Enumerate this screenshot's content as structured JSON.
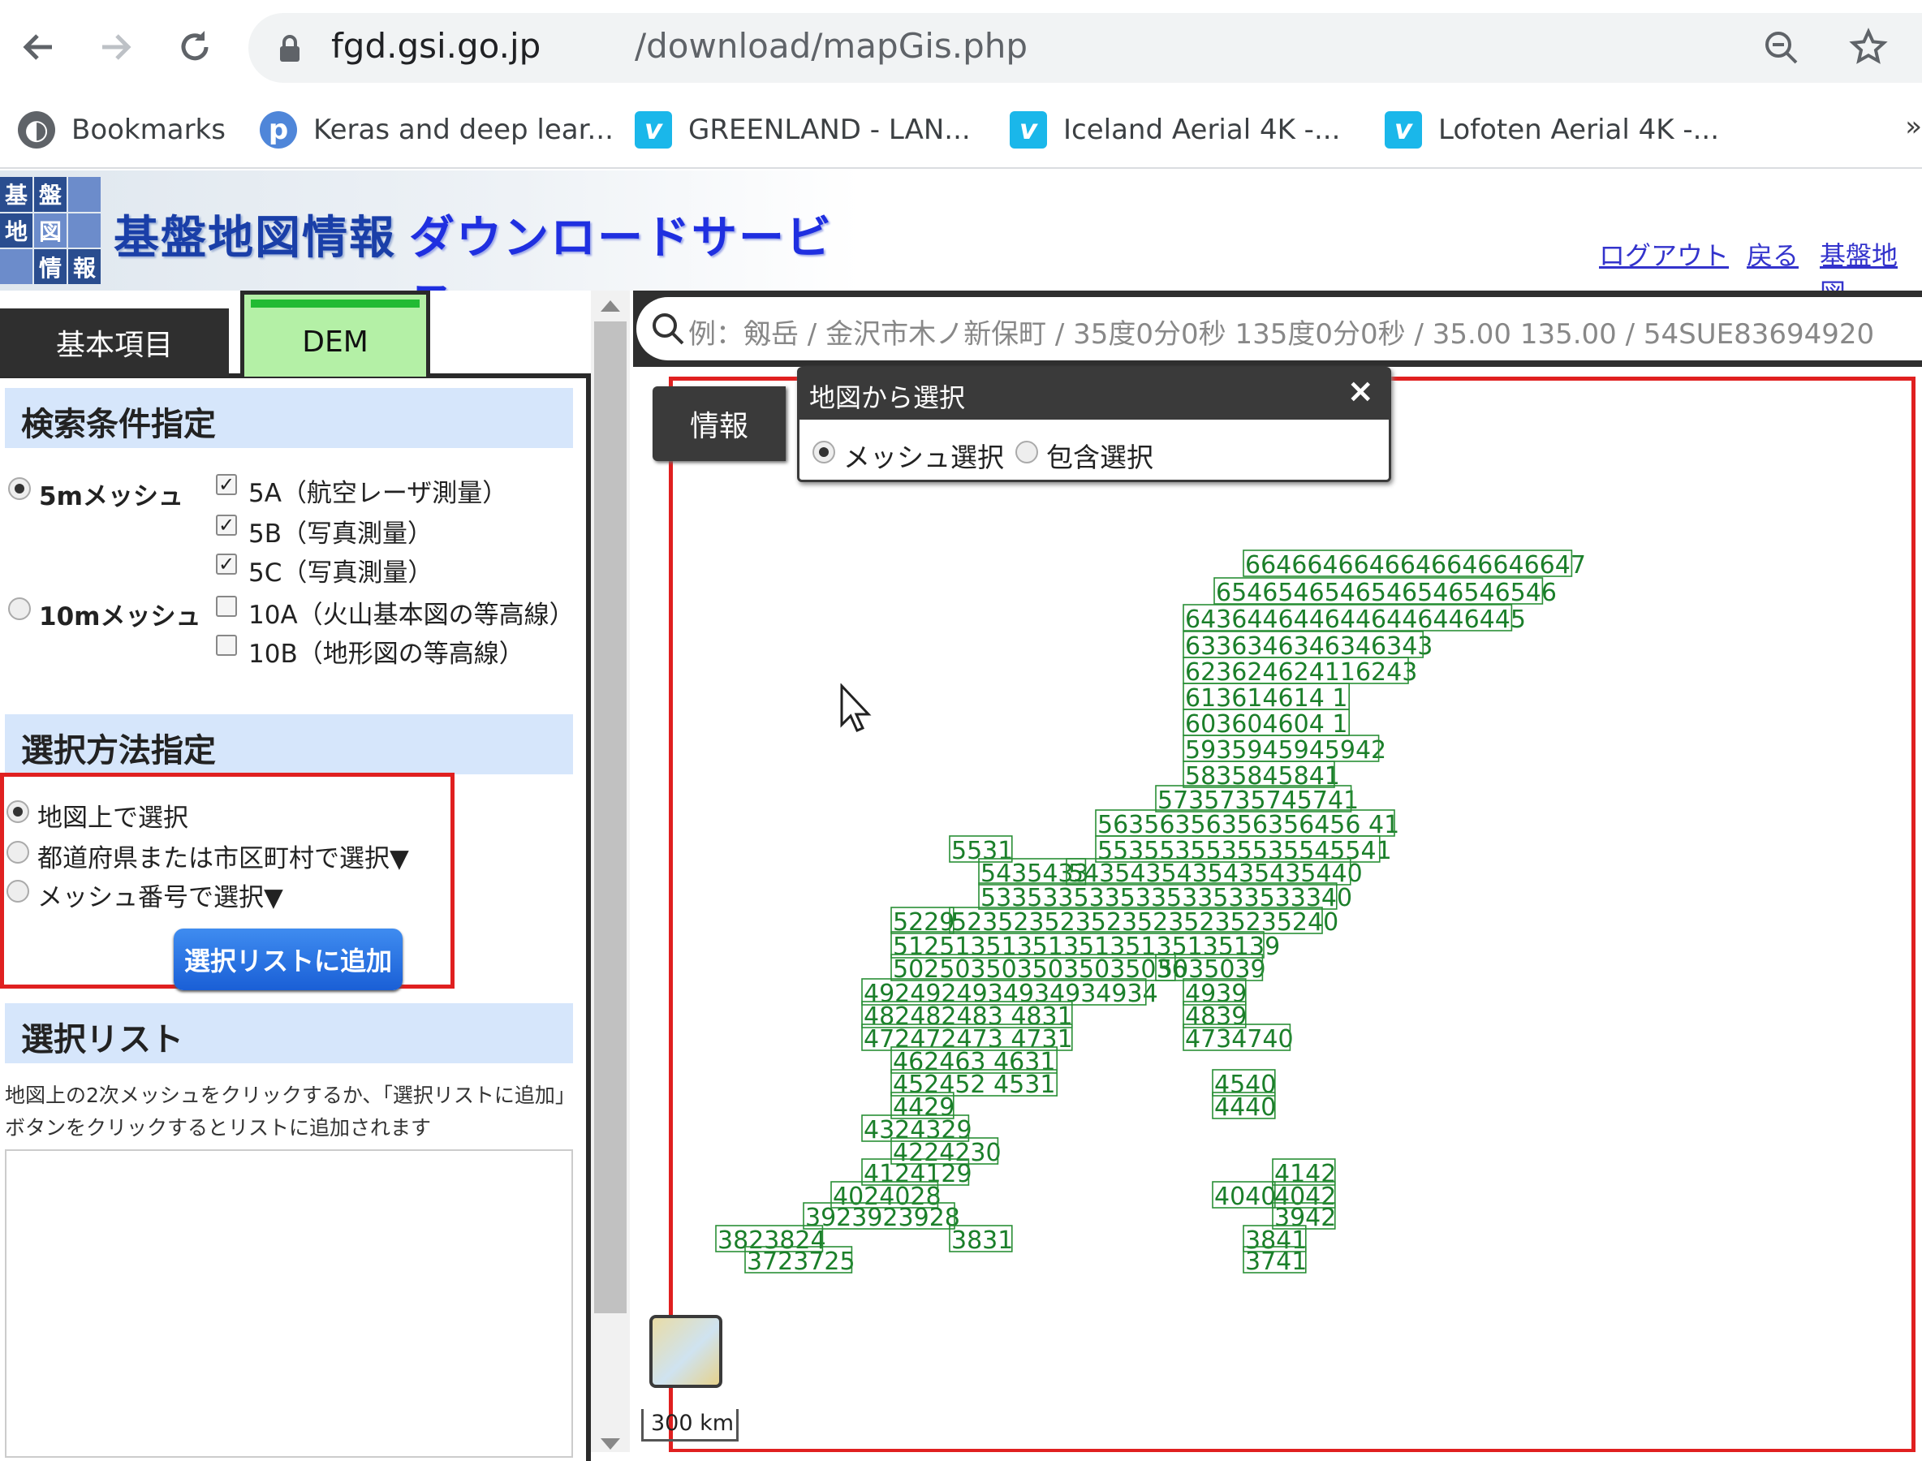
{
  "browser": {
    "url_domain": "fgd.gsi.go.jp",
    "url_path": "/download/mapGis.php",
    "bookmarks": [
      {
        "label": "Bookmarks",
        "icon": "globe-icon"
      },
      {
        "label": "Keras and deep lear...",
        "icon": "p-circle-icon"
      },
      {
        "label": "GREENLAND - LAN...",
        "icon": "vimeo-icon"
      },
      {
        "label": "Iceland Aerial 4K -...",
        "icon": "vimeo-icon"
      },
      {
        "label": "Lofoten Aerial 4K -...",
        "icon": "vimeo-icon"
      }
    ],
    "more": "»"
  },
  "header": {
    "logo_chars": [
      "基",
      "盤",
      "",
      "地",
      "図",
      "",
      "情",
      "報",
      ""
    ],
    "title": "基盤地図情報",
    "subtitle": "ダウンロードサービス",
    "links": {
      "logout": "ログアウト",
      "back": "戻る",
      "kiban": "基盤地図"
    }
  },
  "tabs": {
    "basic": "基本項目",
    "dem": "DEM"
  },
  "search_conditions": {
    "heading": "検索条件指定",
    "mesh5": "5mメッシュ",
    "mesh10": "10mメッシュ",
    "opt_5a": "5A（航空レーザ測量）",
    "opt_5b": "5B（写真測量）",
    "opt_5c": "5C（写真測量）",
    "opt_10a": "10A（火山基本図の等高線）",
    "opt_10b": "10B（地形図の等高線）"
  },
  "selection_method": {
    "heading": "選択方法指定",
    "on_map": "地図上で選択",
    "by_pref": "都道府県または市区町村で選択▼",
    "by_mesh": "メッシュ番号で選択▼",
    "add_button": "選択リストに追加"
  },
  "selection_list": {
    "heading": "選択リスト",
    "hint": "地図上の2次メッシュをクリックするか、「選択リストに追加」ボタンをクリックするとリストに追加されます"
  },
  "map": {
    "search_placeholder": "例：剱岳 / 金沢市木ノ新保町 / 35度0分0秒 135度0分0秒 / 35.00 135.00 / 54SUE83694920",
    "info_button": "情報",
    "popup_title": "地図から選択",
    "popup_close": "×",
    "popup_mesh_select": "メッシュ選択",
    "popup_contain_select": "包含選択",
    "scale": "300 km",
    "mesh_rows": [
      {
        "text": "6646646646646646646647"
      },
      {
        "text": "6546546546546546546546"
      },
      {
        "text": "6436446446446446446445"
      },
      {
        "text": "6336346346346343"
      },
      {
        "text": "623624624116243"
      },
      {
        "text": "613614614 1"
      },
      {
        "text": "603604604 1"
      },
      {
        "text": "5935945945942"
      },
      {
        "text": "5835845841"
      },
      {
        "text": "5735735745741"
      },
      {
        "text": "56356356356356456 41"
      },
      {
        "text": "5531"
      },
      {
        "text": "5535535535535545541"
      },
      {
        "text": "5435433"
      },
      {
        "text": "5435435435435435440"
      },
      {
        "text": "533533533533533533533340"
      },
      {
        "text": "5229"
      },
      {
        "text": "5235235235235235235235240"
      },
      {
        "text": "5125135135135135135135139"
      },
      {
        "text": "5025035035035035036"
      },
      {
        "text": "5035039"
      },
      {
        "text": "4924924934934934934"
      },
      {
        "text": "4939"
      },
      {
        "text": "482482483 4831"
      },
      {
        "text": "4839"
      },
      {
        "text": "472472473 4731"
      },
      {
        "text": "4734740"
      },
      {
        "text": "462463 4631"
      },
      {
        "text": "452452 4531"
      },
      {
        "text": "4540"
      },
      {
        "text": "4429"
      },
      {
        "text": "4440"
      },
      {
        "text": "4324329"
      },
      {
        "text": "4224230"
      },
      {
        "text": "4124129"
      },
      {
        "text": "4142"
      },
      {
        "text": "4024028"
      },
      {
        "text": "4040"
      },
      {
        "text": "4042"
      },
      {
        "text": "3923923928"
      },
      {
        "text": "3942"
      },
      {
        "text": "3823824"
      },
      {
        "text": "3831"
      },
      {
        "text": "3841"
      },
      {
        "text": "3723725"
      },
      {
        "text": "3741"
      }
    ]
  }
}
